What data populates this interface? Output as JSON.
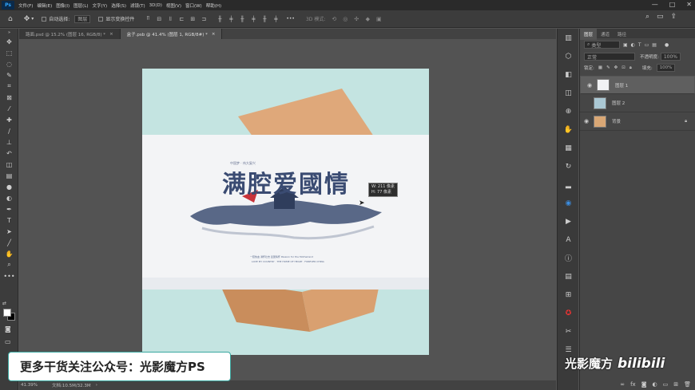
{
  "app": {
    "logo": "Ps",
    "menu": [
      "文件(F)",
      "编辑(E)",
      "图像(I)",
      "图层(L)",
      "文字(Y)",
      "选择(S)",
      "滤镜(T)",
      "3D(D)",
      "视图(V)",
      "窗口(W)",
      "帮助(H)"
    ]
  },
  "options": {
    "auto_select_label": "自动选择:",
    "auto_select_value": "图层",
    "show_transform_label": "显示变换控件",
    "mode_3d_label": "3D 模式:"
  },
  "tabs": [
    {
      "label": "路面.psd @ 15.2% (图层 16, RGB/8) *"
    },
    {
      "label": "盒子.psb @ 41.4% (图层 1, RGB/8#) *"
    }
  ],
  "canvas": {
    "poster_small_text": "中国梦 · 伟大复兴",
    "poster_title": "满腔爱國情",
    "poster_caption_1": "一腔热血 满怀壮志 爱国情怀 Passion for the Motherland",
    "poster_caption_2": "LOVE MY COUNTRY · THE HOME OF HEART · FOREVER CHINA",
    "tooltip_w": "W: 211 像素",
    "tooltip_h": "H: 77 像素"
  },
  "status": {
    "zoom": "41.39%",
    "doc": "文档:10.5M/32.3M"
  },
  "layers_panel": {
    "tabs": [
      "图层",
      "通道",
      "路径"
    ],
    "filter_label": "类型",
    "blend_mode": "正常",
    "opacity_label": "不透明度:",
    "opacity_value": "100%",
    "lock_label": "锁定:",
    "fill_label": "填充:",
    "fill_value": "100%",
    "layers": [
      {
        "name": "图层 1"
      },
      {
        "name": "图层 2"
      },
      {
        "name": "背景"
      }
    ]
  },
  "overlay": {
    "promo": "更多干货关注公众号：光影魔方PS",
    "watermark_1": "光影魔方",
    "watermark_2": "bilibili"
  }
}
